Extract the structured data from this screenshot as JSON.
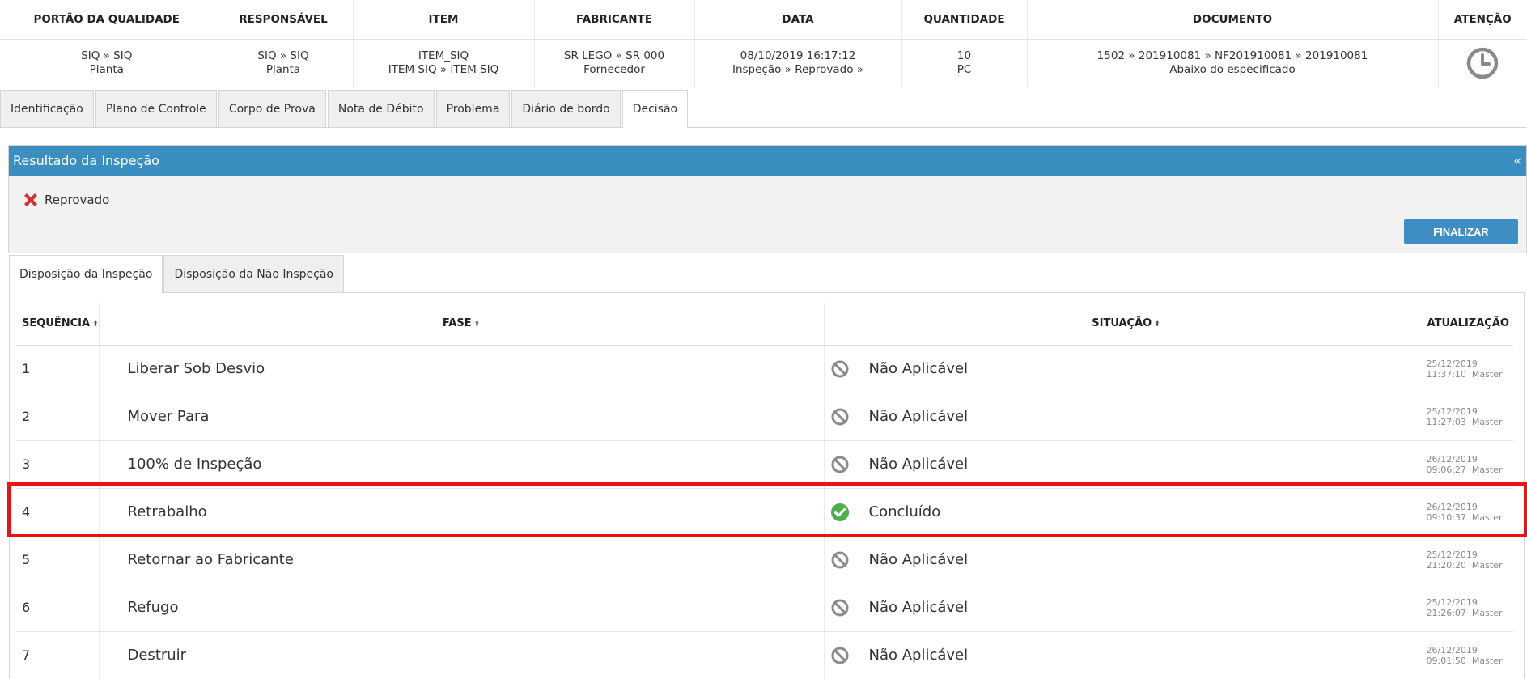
{
  "summary": {
    "headers": {
      "portao": "PORTÃO DA QUALIDADE",
      "responsavel": "RESPONSÁVEL",
      "item": "ITEM",
      "fabricante": "FABRICANTE",
      "data": "DATA",
      "quantidade": "QUANTIDADE",
      "documento": "DOCUMENTO",
      "atencao": "ATENÇÃO"
    },
    "values": {
      "portao": {
        "line1": "SIQ » SIQ",
        "line2": "Planta"
      },
      "responsavel": {
        "line1": "SIQ » SIQ",
        "line2": "Planta"
      },
      "item": {
        "line1": "ITEM_SIQ",
        "line2": "ITEM SIQ » ITEM SIQ"
      },
      "fabricante": {
        "line1": "SR LEGO » SR 000",
        "line2": "Fornecedor"
      },
      "data": {
        "line1": "08/10/2019 16:17:12",
        "line2": "Inspeção » Reprovado »"
      },
      "quantidade": {
        "line1": "10",
        "line2": "PC"
      },
      "documento": {
        "line1": "1502 » 201910081 » NF201910081 » 201910081",
        "line2": "Abaixo do especificado"
      },
      "atencao_icon": "clock-icon"
    }
  },
  "tabs": [
    {
      "label": "Identificação",
      "active": false
    },
    {
      "label": "Plano de Controle",
      "active": false
    },
    {
      "label": "Corpo de Prova",
      "active": false
    },
    {
      "label": "Nota de Débito",
      "active": false
    },
    {
      "label": "Problema",
      "active": false
    },
    {
      "label": "Diário de bordo",
      "active": false
    },
    {
      "label": "Decisão",
      "active": true
    }
  ],
  "result_panel": {
    "title": "Resultado da Inspeção",
    "collapse": "«",
    "status_label": "Reprovado",
    "status_icon": "x-icon",
    "finalize_label": "FINALIZAR",
    "header_color": "#3b8fc0",
    "button_color": "#3d8ec3"
  },
  "subtabs": [
    {
      "label": "Disposição da Inspeção",
      "active": true
    },
    {
      "label": "Disposição da Não Inspeção",
      "active": false
    }
  ],
  "grid": {
    "headers": {
      "seq": "SEQUÊNCIA",
      "fase": "FASE",
      "situacao": "SITUAÇÃO",
      "atualizacao": "ATUALIZAÇÃO",
      "sort_icon": "⬍"
    },
    "rows": [
      {
        "seq": "1",
        "fase": "Liberar Sob Desvio",
        "status": "Não Aplicável",
        "status_icon": "na",
        "date": "25/12/2019",
        "time": "11:37:10",
        "user": "Master"
      },
      {
        "seq": "2",
        "fase": "Mover Para",
        "status": "Não Aplicável",
        "status_icon": "na",
        "date": "25/12/2019",
        "time": "11:27:03",
        "user": "Master"
      },
      {
        "seq": "3",
        "fase": "100% de Inspeção",
        "status": "Não Aplicável",
        "status_icon": "na",
        "date": "26/12/2019",
        "time": "09:06:27",
        "user": "Master"
      },
      {
        "seq": "4",
        "fase": "Retrabalho",
        "status": "Concluído",
        "status_icon": "ok",
        "date": "26/12/2019",
        "time": "09:10:37",
        "user": "Master"
      },
      {
        "seq": "5",
        "fase": "Retornar ao Fabricante",
        "status": "Não Aplicável",
        "status_icon": "na",
        "date": "25/12/2019",
        "time": "21:20:20",
        "user": "Master"
      },
      {
        "seq": "6",
        "fase": "Refugo",
        "status": "Não Aplicável",
        "status_icon": "na",
        "date": "25/12/2019",
        "time": "21:26:07",
        "user": "Master"
      },
      {
        "seq": "7",
        "fase": "Destruir",
        "status": "Não Aplicável",
        "status_icon": "na",
        "date": "26/12/2019",
        "time": "09:01:50",
        "user": "Master"
      }
    ],
    "colors": {
      "ok": "#4cae4c",
      "na": "#8a8a8a",
      "highlight": "#ee1111"
    }
  }
}
